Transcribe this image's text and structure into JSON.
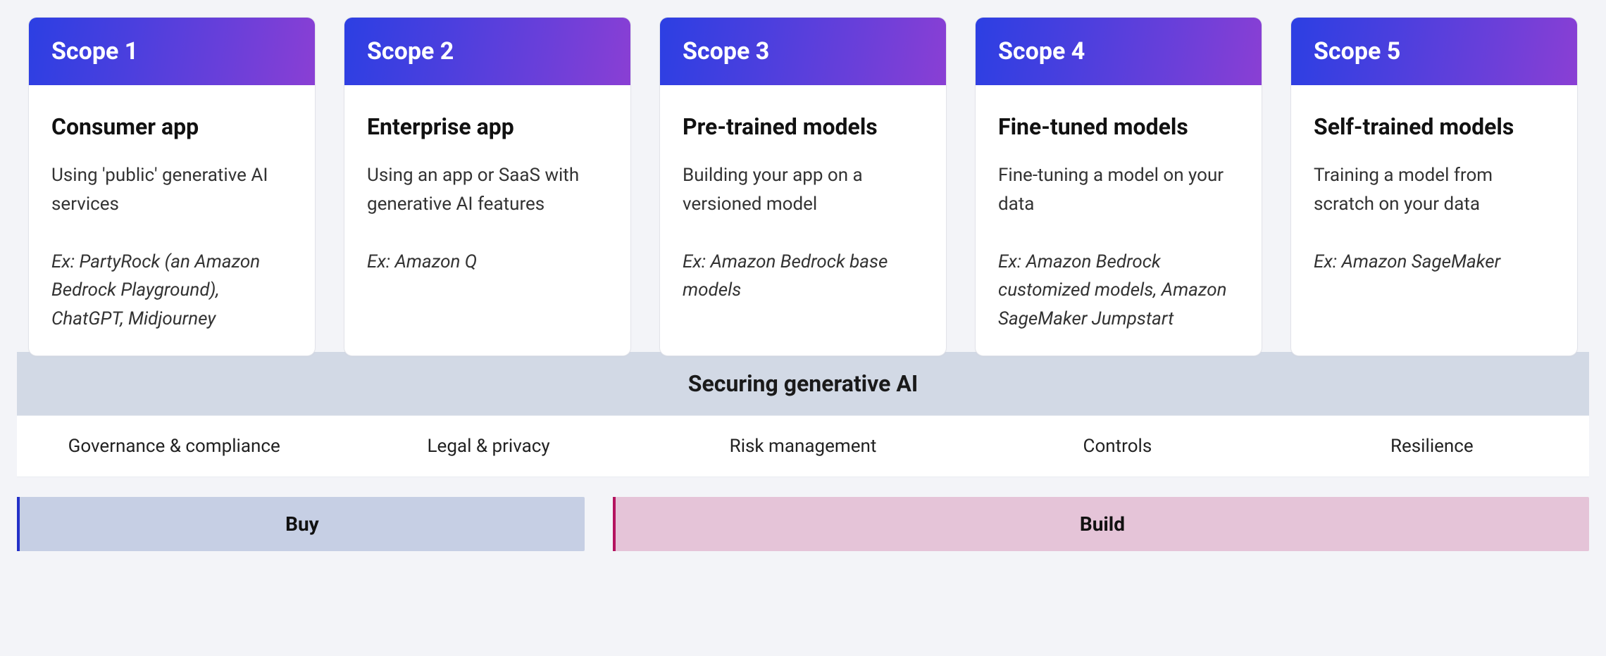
{
  "scopes": [
    {
      "header": "Scope 1",
      "title": "Consumer app",
      "desc": "Using 'public' generative AI services",
      "example": "Ex: PartyRock (an Amazon Bedrock Playground), ChatGPT, Midjourney"
    },
    {
      "header": "Scope 2",
      "title": "Enterprise app",
      "desc": "Using an app or SaaS with generative AI features",
      "example": "Ex: Amazon Q"
    },
    {
      "header": "Scope 3",
      "title": "Pre-trained models",
      "desc": "Building your app on a versioned model",
      "example": "Ex: Amazon Bedrock base models"
    },
    {
      "header": "Scope 4",
      "title": "Fine-tuned models",
      "desc": "Fine-tuning a model on your data",
      "example": "Ex: Amazon Bedrock customized models, Amazon SageMaker Jumpstart"
    },
    {
      "header": "Scope 5",
      "title": "Self-trained models",
      "desc": "Training a model from scratch on your data",
      "example": "Ex: Amazon SageMaker"
    }
  ],
  "securing_title": "Securing generative AI",
  "pillars": [
    "Governance & compliance",
    "Legal & privacy",
    "Risk management",
    "Controls",
    "Resilience"
  ],
  "categories": {
    "buy": "Buy",
    "build": "Build"
  }
}
